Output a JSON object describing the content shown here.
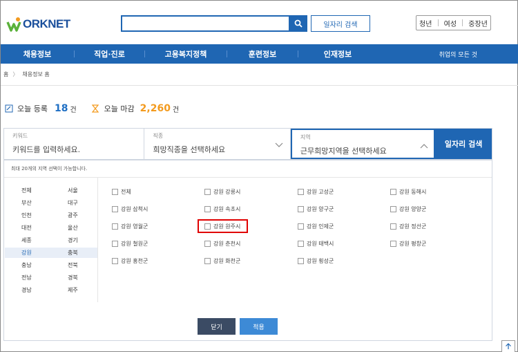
{
  "header": {
    "logo_text": "ORKNET",
    "search_value": "",
    "job_search_label": "일자리 검색",
    "audience": [
      "청년",
      "여성",
      "중장년"
    ]
  },
  "nav": {
    "items": [
      "채용정보",
      "직업·진로",
      "고용복지정책",
      "훈련정보",
      "인재정보"
    ],
    "all_menu": "취업의 모든 것"
  },
  "breadcrumb": [
    "홈",
    "채용정보 홈"
  ],
  "stats": {
    "today_registered_label": "오늘 등록",
    "today_registered": "18",
    "today_closing_label": "오늘 마감",
    "today_closing": "2,260",
    "unit": "건"
  },
  "filter": {
    "keyword_label": "키워드",
    "keyword_placeholder": "키워드를 입력하세요.",
    "job_label": "직종",
    "job_placeholder": "희망직종을 선택하세요",
    "region_label": "지역",
    "region_placeholder": "근무희망지역을 선택하세요",
    "search_button": "일자리 검색"
  },
  "panel": {
    "note": "최대 20개의 지역 선택이 가능합니다.",
    "regions_left": [
      "전체",
      "부산",
      "인천",
      "대전",
      "세종",
      "강원",
      "충남",
      "전남",
      "경남"
    ],
    "regions_right": [
      "서울",
      "대구",
      "광주",
      "울산",
      "경기",
      "충북",
      "전북",
      "경북",
      "제주"
    ],
    "selected_region": "강원",
    "districts": [
      [
        "전체",
        "강원 강릉시",
        "강원 고성군",
        "강원 동해시"
      ],
      [
        "강원 삼척시",
        "강원 속초시",
        "강원 양구군",
        "강원 양양군"
      ],
      [
        "강원 영월군",
        "강원 원주시",
        "강원 인제군",
        "강원 정선군"
      ],
      [
        "강원 철원군",
        "강원 춘천시",
        "강원 태백시",
        "강원 평창군"
      ],
      [
        "강원 홍천군",
        "강원 화천군",
        "강원 횡성군"
      ]
    ],
    "close_button": "닫기",
    "apply_button": "적용"
  }
}
